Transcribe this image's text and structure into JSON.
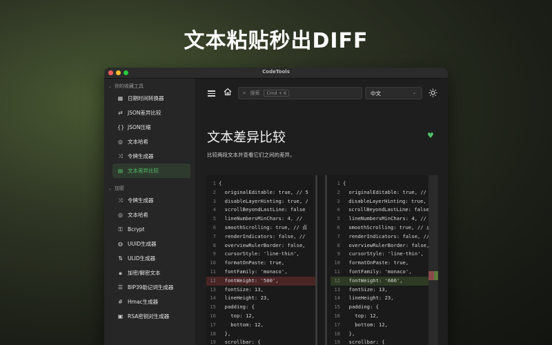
{
  "headline": "文本粘贴秒出DIFF",
  "window": {
    "title": "CodeTools",
    "traffic_colors": [
      "#ff5f57",
      "#febc2e",
      "#28c840"
    ]
  },
  "sidebar": {
    "favorites_title": "你的收藏工具",
    "favorites": [
      {
        "icon": "calendar-icon",
        "label": "日期时间转换器"
      },
      {
        "icon": "compare-icon",
        "label": "JSON差异比较"
      },
      {
        "icon": "braces-icon",
        "label": "JSON压缩"
      },
      {
        "icon": "eye-slash-icon",
        "label": "文本哈希"
      },
      {
        "icon": "shuffle-icon",
        "label": "令牌生成器"
      },
      {
        "icon": "document-icon",
        "label": "文本差异比较",
        "active": true
      }
    ],
    "crypto_title": "加密",
    "crypto": [
      {
        "icon": "shuffle-icon",
        "label": "令牌生成器"
      },
      {
        "icon": "eye-slash-icon",
        "label": "文本哈希"
      },
      {
        "icon": "key-icon",
        "label": "Bcrypt"
      },
      {
        "icon": "fingerprint-icon",
        "label": "UUID生成器"
      },
      {
        "icon": "sort-icon",
        "label": "ULID生成器"
      },
      {
        "icon": "lock-icon",
        "label": "加密/解密文本"
      },
      {
        "icon": "list-icon",
        "label": "BIP39助记词生成器"
      },
      {
        "icon": "hash-icon",
        "label": "Hmac生成器"
      },
      {
        "icon": "id-card-icon",
        "label": "RSA密钥对生成器"
      }
    ]
  },
  "toolbar": {
    "search_placeholder": "搜索",
    "search_shortcut": "Cmd + K",
    "language": "中文"
  },
  "page": {
    "title": "文本差异比较",
    "description": "比较两段文本并查看它们之间的差异。"
  },
  "accent_color": "#4fbf6a",
  "editor": {
    "left": [
      {
        "n": "1",
        "t": "{"
      },
      {
        "n": "2",
        "t": "  originalEditable: true, // 5"
      },
      {
        "n": "3",
        "t": "  disableLayerHinting: true, /"
      },
      {
        "n": "4",
        "t": "  scrollBeyondLastLine: false"
      },
      {
        "n": "5",
        "t": "  lineNumbersMinChars: 4, // "
      },
      {
        "n": "6",
        "t": "  smoothScrolling: true, // 点"
      },
      {
        "n": "7",
        "t": "  renderIndicators: false, //"
      },
      {
        "n": "8",
        "t": "  overviewRulerBorder: false,"
      },
      {
        "n": "9",
        "t": "  cursorStyle: 'line-thin',"
      },
      {
        "n": "10",
        "t": "  formatOnPaste: true,"
      },
      {
        "n": "11",
        "t": "  fontFamily: 'monaco',"
      },
      {
        "n": "12",
        "t": "  fontWeight: '500',",
        "type": "del"
      },
      {
        "n": "13",
        "t": "  fontSize: 13,"
      },
      {
        "n": "14",
        "t": "  lineHeight: 23,"
      },
      {
        "n": "15",
        "t": "  padding: {"
      },
      {
        "n": "16",
        "t": "    top: 12,"
      },
      {
        "n": "17",
        "t": "    bottom: 12,"
      },
      {
        "n": "18",
        "t": "  },"
      },
      {
        "n": "19",
        "t": "  scrollbar: {"
      }
    ],
    "right": [
      {
        "n": "1",
        "t": "{"
      },
      {
        "n": "2",
        "t": "  originalEditable: true, // "
      },
      {
        "n": "3",
        "t": "  disableLayerHinting: true, /"
      },
      {
        "n": "4",
        "t": "  scrollBeyondLastLine: false,"
      },
      {
        "n": "5",
        "t": "  lineNumbersMinChars: 4, // "
      },
      {
        "n": "6",
        "t": "  smoothScrolling: true, // 点"
      },
      {
        "n": "7",
        "t": "  renderIndicators: false, //"
      },
      {
        "n": "8",
        "t": "  overviewRulerBorder: false,"
      },
      {
        "n": "9",
        "t": "  cursorStyle: 'line-thin',"
      },
      {
        "n": "10",
        "t": "  formatOnPaste: true,"
      },
      {
        "n": "11",
        "t": "  fontFamily: 'monaco',"
      },
      {
        "n": "12",
        "t": "  fontWeight: '666',",
        "type": "add"
      },
      {
        "n": "13",
        "t": "  fontSize: 13,"
      },
      {
        "n": "14",
        "t": "  lineHeight: 23,"
      },
      {
        "n": "15",
        "t": "  padding: {"
      },
      {
        "n": "16",
        "t": "    top: 12,"
      },
      {
        "n": "17",
        "t": "    bottom: 12,"
      },
      {
        "n": "18",
        "t": "  },"
      },
      {
        "n": "19",
        "t": "  scrollbar: {"
      }
    ]
  }
}
